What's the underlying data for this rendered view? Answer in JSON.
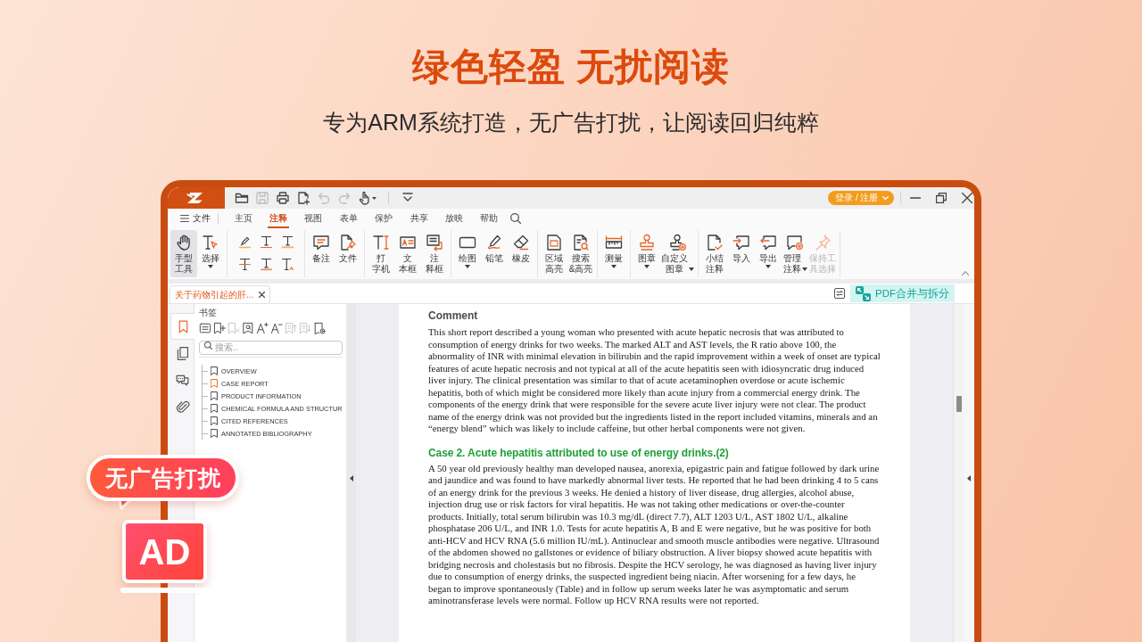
{
  "hero": {
    "title": "绿色轻盈 无扰阅读",
    "subtitle": "专为ARM系统打造，无广告打扰，让阅读回归纯粹"
  },
  "callouts": {
    "bubble": "无广告打扰",
    "ad": "AD"
  },
  "app": {
    "title_bar": {
      "quick_access": [
        {
          "disabled": false
        },
        {
          "disabled": true
        },
        {
          "disabled": false
        },
        {
          "disabled": false
        },
        {
          "disabled": true
        },
        {
          "disabled": true
        },
        {
          "disabled": false
        },
        {
          "disabled": false
        }
      ],
      "login": "登录 / 注册"
    },
    "menu": {
      "file": "文件",
      "tabs": [
        {
          "label": "主页",
          "selected": false
        },
        {
          "label": "注释",
          "selected": true
        },
        {
          "label": "视图",
          "selected": false
        },
        {
          "label": "表单",
          "selected": false
        },
        {
          "label": "保护",
          "selected": false
        },
        {
          "label": "共享",
          "selected": false
        },
        {
          "label": "放映",
          "selected": false
        },
        {
          "label": "帮助",
          "selected": false
        }
      ]
    },
    "ribbon": {
      "groups": [
        {
          "kind": "large",
          "tools": [
            {
              "lines": [
                "手型",
                "工具"
              ],
              "dropdown": false,
              "selected": true,
              "disabled": false
            },
            {
              "lines": [
                "选择"
              ],
              "dropdown": true,
              "selected": false,
              "disabled": false
            }
          ]
        },
        {
          "kind": "small",
          "tools": [
            {
              "selected": false,
              "disabled": false
            },
            {
              "selected": false,
              "disabled": false
            },
            {
              "selected": false,
              "disabled": false
            },
            {
              "selected": false,
              "disabled": false
            },
            {
              "selected": false,
              "disabled": false
            },
            {
              "selected": false,
              "disabled": false
            }
          ]
        },
        {
          "kind": "large",
          "tools": [
            {
              "lines": [
                "备注"
              ],
              "dropdown": false,
              "selected": false,
              "disabled": false
            },
            {
              "lines": [
                "文件"
              ],
              "dropdown": false,
              "selected": false,
              "disabled": false
            }
          ]
        },
        {
          "kind": "large",
          "tools": [
            {
              "lines": [
                "打",
                "字机"
              ],
              "dropdown": false,
              "selected": false,
              "disabled": false
            },
            {
              "lines": [
                "文",
                "本框"
              ],
              "dropdown": false,
              "selected": false,
              "disabled": false
            },
            {
              "lines": [
                "注",
                "释框"
              ],
              "dropdown": false,
              "selected": false,
              "disabled": false
            }
          ]
        },
        {
          "kind": "large",
          "tools": [
            {
              "lines": [
                "绘图"
              ],
              "dropdown": true,
              "selected": false,
              "disabled": false
            },
            {
              "lines": [
                "铅笔"
              ],
              "dropdown": false,
              "selected": false,
              "disabled": false
            },
            {
              "lines": [
                "橡皮"
              ],
              "dropdown": false,
              "selected": false,
              "disabled": false
            }
          ]
        },
        {
          "kind": "large",
          "tools": [
            {
              "lines": [
                "区域",
                "高亮"
              ],
              "dropdown": false,
              "selected": false,
              "disabled": false
            },
            {
              "lines": [
                "搜索",
                "&高亮"
              ],
              "dropdown": false,
              "selected": false,
              "disabled": false
            }
          ]
        },
        {
          "kind": "large",
          "tools": [
            {
              "lines": [
                "测量"
              ],
              "dropdown": true,
              "selected": false,
              "disabled": false
            }
          ]
        },
        {
          "kind": "large",
          "tools": [
            {
              "lines": [
                "图章"
              ],
              "dropdown": true,
              "selected": false,
              "disabled": false
            },
            {
              "lines": [
                "自定义",
                "图章"
              ],
              "dropdown": true,
              "selected": false,
              "disabled": false
            }
          ]
        },
        {
          "kind": "large",
          "tools": [
            {
              "lines": [
                "小结",
                "注释"
              ],
              "dropdown": false,
              "selected": false,
              "disabled": false
            },
            {
              "lines": [
                "导入"
              ],
              "dropdown": false,
              "selected": false,
              "disabled": false
            },
            {
              "lines": [
                "导出"
              ],
              "dropdown": true,
              "selected": false,
              "disabled": false
            },
            {
              "lines": [
                "管理",
                "注释"
              ],
              "dropdown": true,
              "selected": false,
              "disabled": false
            },
            {
              "lines": [
                "保持工",
                "具选择"
              ],
              "dropdown": false,
              "selected": false,
              "disabled": true
            }
          ]
        }
      ]
    },
    "document_tabs": [
      {
        "title": "关于药物引起的肝...",
        "selected": true
      }
    ],
    "merge_button": "PDF合并与拆分",
    "side_tabs": [
      {
        "selected": true
      },
      {
        "selected": false
      },
      {
        "selected": false
      },
      {
        "selected": false
      }
    ],
    "bookmarks": {
      "title": "书签",
      "toolbar": [
        {
          "disabled": false
        },
        {
          "disabled": false
        },
        {
          "disabled": true
        },
        {
          "disabled": false
        },
        {
          "disabled": false
        },
        {
          "disabled": false
        },
        {
          "disabled": true
        },
        {
          "disabled": true
        },
        {
          "disabled": false
        }
      ],
      "search": {
        "placeholder": "搜索.."
      },
      "items": [
        {
          "label": "OVERVIEW",
          "selected": false
        },
        {
          "label": "CASE REPORT",
          "selected": true
        },
        {
          "label": "PRODUCT INFORMATION",
          "selected": false
        },
        {
          "label": "CHEMICAL FORMULA AND STRUCTUR",
          "selected": false
        },
        {
          "label": "CITED REFERENCES",
          "selected": false
        },
        {
          "label": "ANNOTATED BIBLIOGRAPHY",
          "selected": false
        }
      ]
    },
    "page": {
      "blocks": [
        {
          "kind": "heading",
          "text": "Comment"
        },
        {
          "kind": "paragraph",
          "text": "This short report described a young woman who presented with acute hepatic necrosis that was attributed to consumption of energy drinks for two weeks. The marked ALT and AST levels, the R ratio above 100, the abnormality of INR with minimal elevation in bilirubin and the rapid improvement within a week of onset are typical features of acute hepatic necrosis and not typical at all of the acute hepatitis seen with idiosyncratic drug induced liver injury. The clinical presentation was similar to that of acute acetaminophen overdose or acute ischemic hepatitis, both of which might be considered more likely than acute injury from a commercial energy drink. The components of the energy drink that were responsible for the severe acute liver injury were not clear. The product name of the energy drink was not provided but the ingredients listed in the report included vitamins, minerals and an “energy blend” which was likely to include caffeine, but other herbal components were not given."
        },
        {
          "kind": "case_heading",
          "text": "Case 2. Acute hepatitis attributed to use of energy drinks.(2)"
        },
        {
          "kind": "paragraph",
          "text": "A 50 year old previously healthy man developed nausea, anorexia, epigastric pain and fatigue followed by dark urine and jaundice and was found to have markedly abnormal liver tests. He reported that he had been drinking 4 to 5 cans of an energy drink for the previous 3 weeks. He denied a history of liver disease, drug allergies, alcohol abuse, injection drug use or risk factors for viral hepatitis. He was not taking other medications or over-the-counter products. Initially, total serum bilirubin was 10.3 mg/dL (direct 7.7), ALT 1203 U/L, AST 1802 U/L, alkaline phosphatase 206 U/L, and INR 1.0. Tests for acute hepatitis A, B and E were negative, but he was positive for both anti-HCV and HCV RNA (5.6 million IU/mL). Antinuclear and smooth muscle antibodies were negative. Ultrasound of the abdomen showed no gallstones or evidence of biliary obstruction. A liver biopsy showed acute hepatitis with bridging necrosis and cholestasis but no fibrosis. Despite the HCV serology, he was diagnosed as having liver injury due to consumption of energy drinks, the suspected ingredient being niacin. After worsening for a few days, he began to improve spontaneously (Table) and in follow up serum weeks later he was asymptomatic and serum aminotransferase levels were normal. Follow up HCV RNA results were not reported."
        }
      ]
    }
  }
}
